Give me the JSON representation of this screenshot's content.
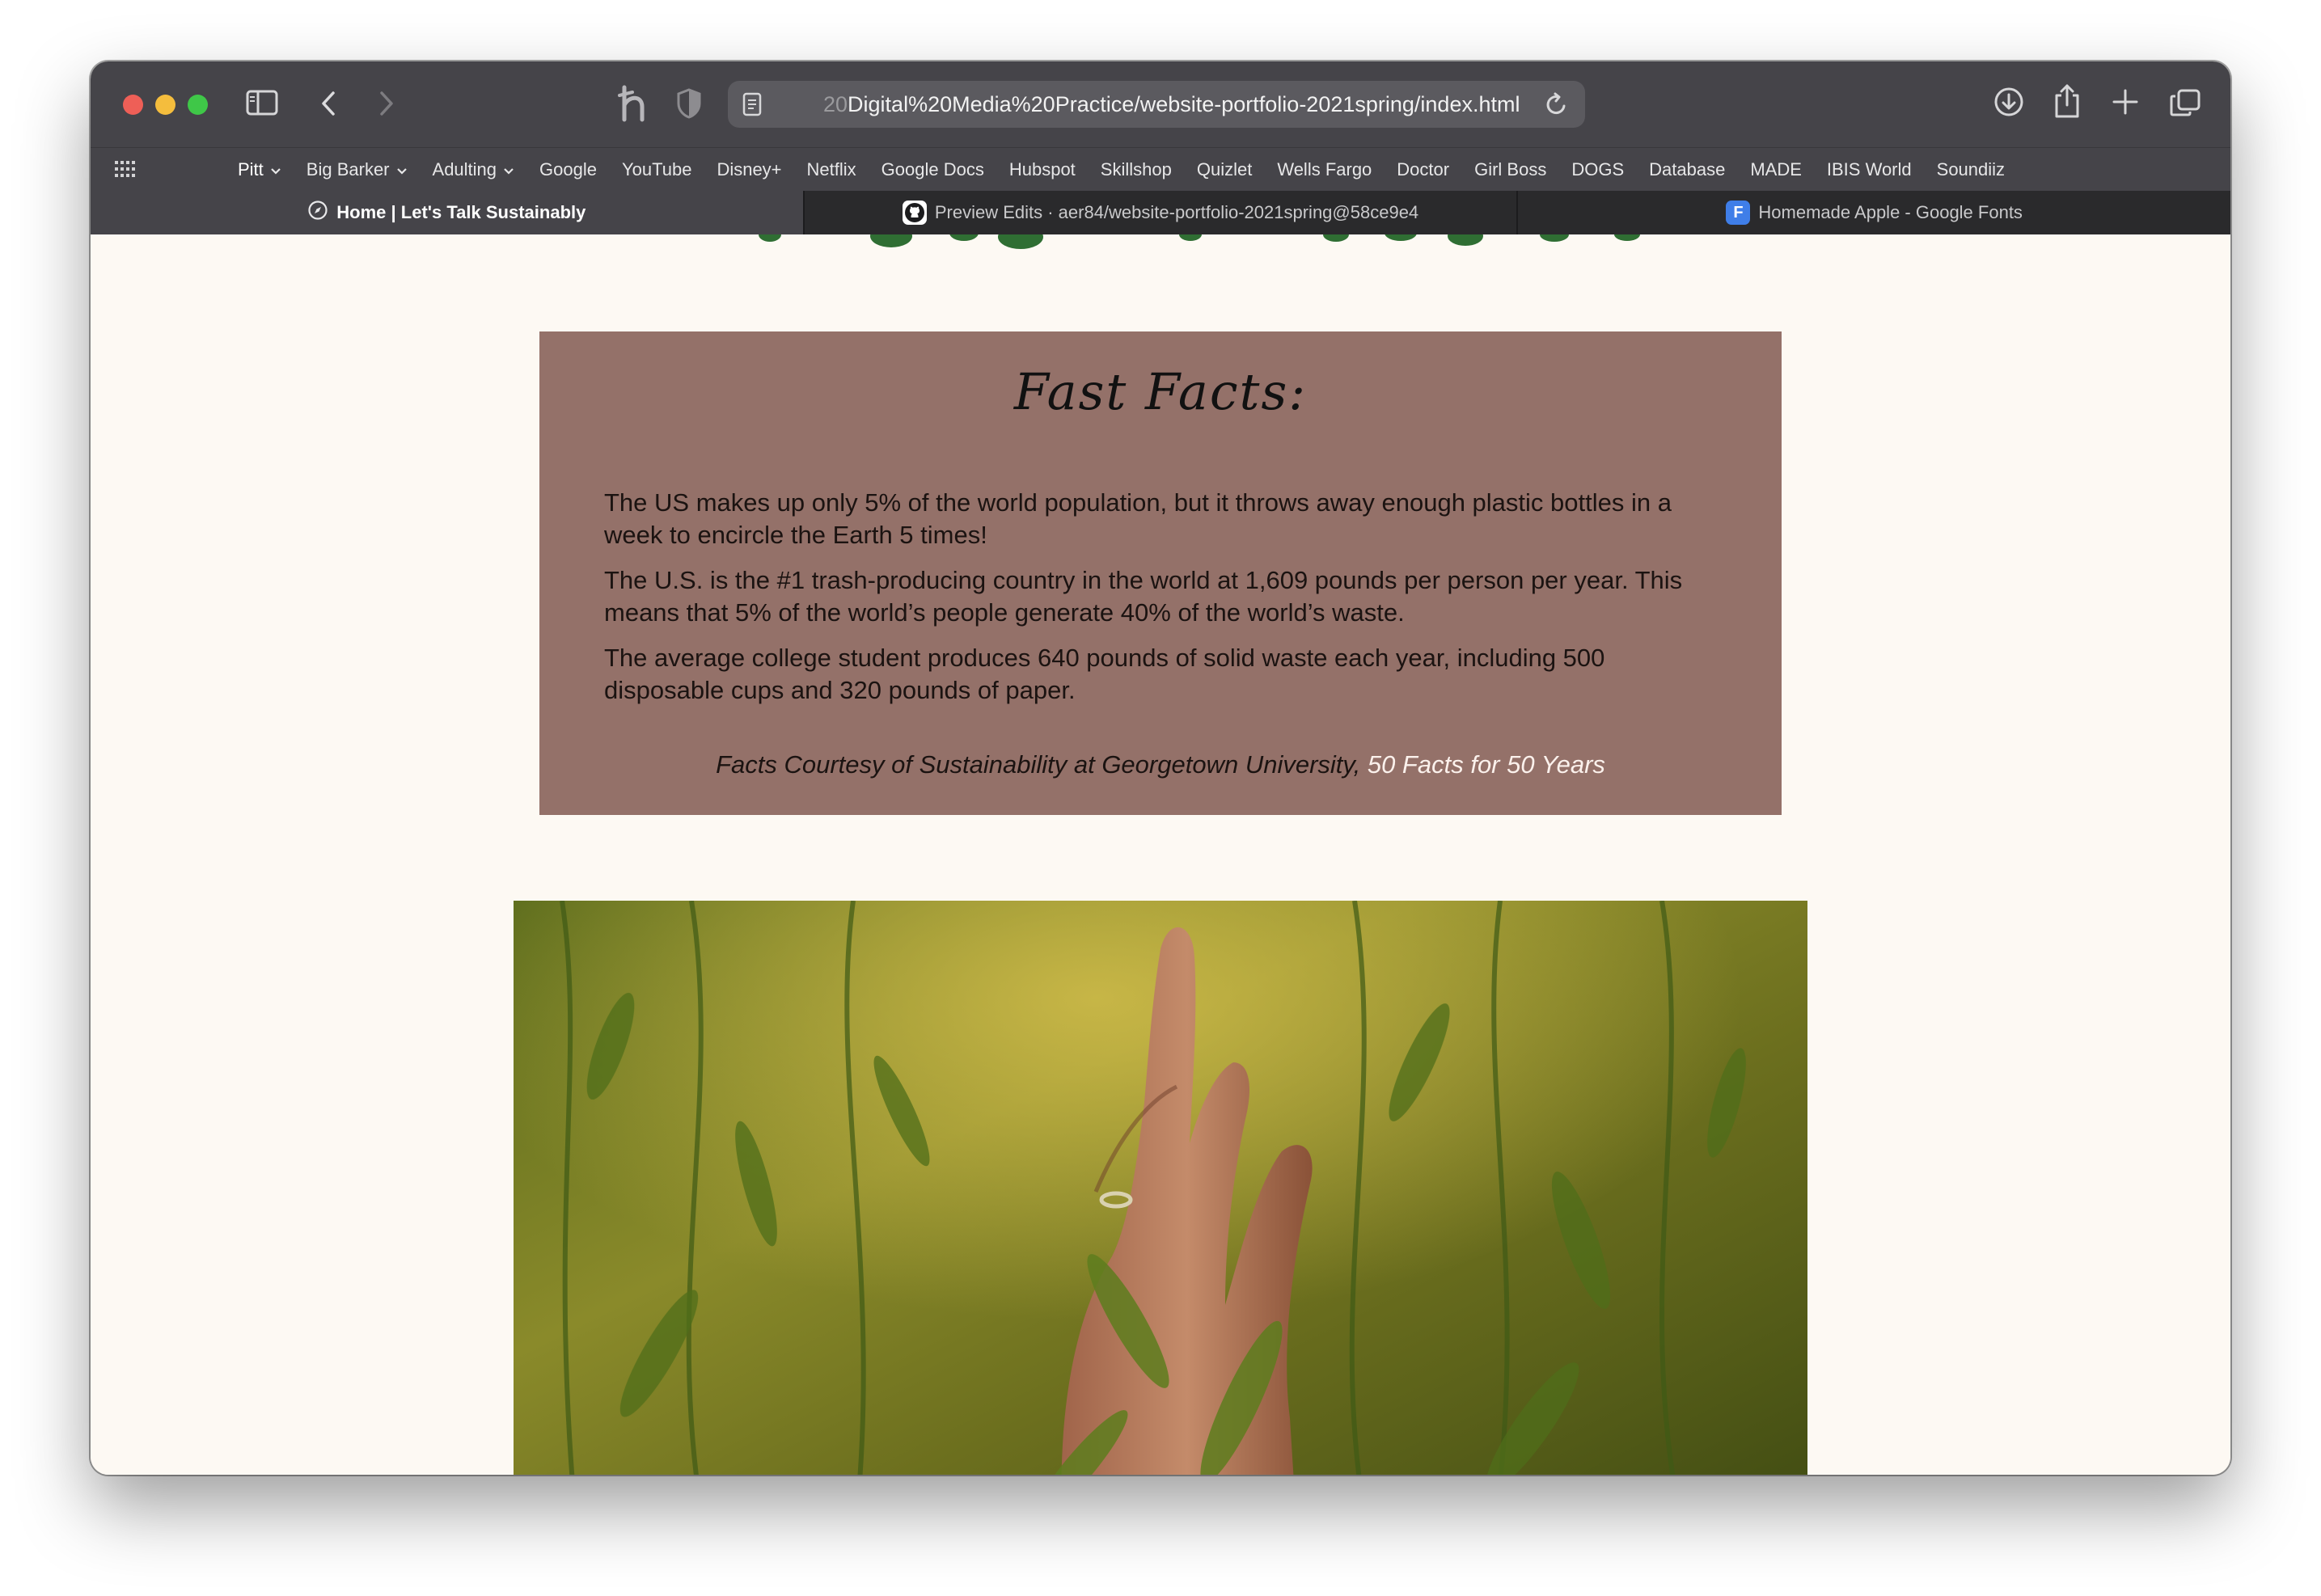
{
  "browser": {
    "url_prefix": "20",
    "url_main": "Digital%20Media%20Practice/website-portfolio-2021spring/index.html",
    "bookmarks": [
      {
        "label": "Pitt",
        "dropdown": true
      },
      {
        "label": "Big Barker",
        "dropdown": true
      },
      {
        "label": "Adulting",
        "dropdown": true
      },
      {
        "label": "Google"
      },
      {
        "label": "YouTube"
      },
      {
        "label": "Disney+"
      },
      {
        "label": "Netflix"
      },
      {
        "label": "Google Docs"
      },
      {
        "label": "Hubspot"
      },
      {
        "label": "Skillshop"
      },
      {
        "label": "Quizlet"
      },
      {
        "label": "Wells Fargo"
      },
      {
        "label": "Doctor"
      },
      {
        "label": "Girl Boss"
      },
      {
        "label": "DOGS"
      },
      {
        "label": "Database"
      },
      {
        "label": "MADE"
      },
      {
        "label": "IBIS World"
      },
      {
        "label": "Soundiiz"
      }
    ],
    "tabs": [
      {
        "title": "Home | Let's Talk Sustainably",
        "icon": "compass-icon",
        "active": true
      },
      {
        "title": "Preview Edits · aer84/website-portfolio-2021spring@58ce9e4",
        "icon": "github-icon",
        "active": false
      },
      {
        "title": "Homemade Apple - Google Fonts",
        "icon": "google-fonts-icon",
        "icon_letter": "F",
        "active": false
      }
    ]
  },
  "page": {
    "facts": {
      "title": "Fast Facts:",
      "items": [
        "The US makes up only 5% of the world population, but it throws away enough plastic bottles in a week to encircle the Earth 5 times!",
        "The U.S. is the #1 trash-producing country in the world at 1,609 pounds per person per year. This means that 5% of the world’s people generate 40% of the world’s waste.",
        "The average college student produces 640 pounds of solid waste each year, including 500 disposable cups and 320 pounds of paper."
      ],
      "credit_text": "Facts Courtesy of Sustainability at Georgetown University, ",
      "credit_link": "50 Facts for 50 Years"
    },
    "colors": {
      "background": "#fdf9f3",
      "facts_box": "#947169",
      "link": "#fbf1ec"
    }
  }
}
